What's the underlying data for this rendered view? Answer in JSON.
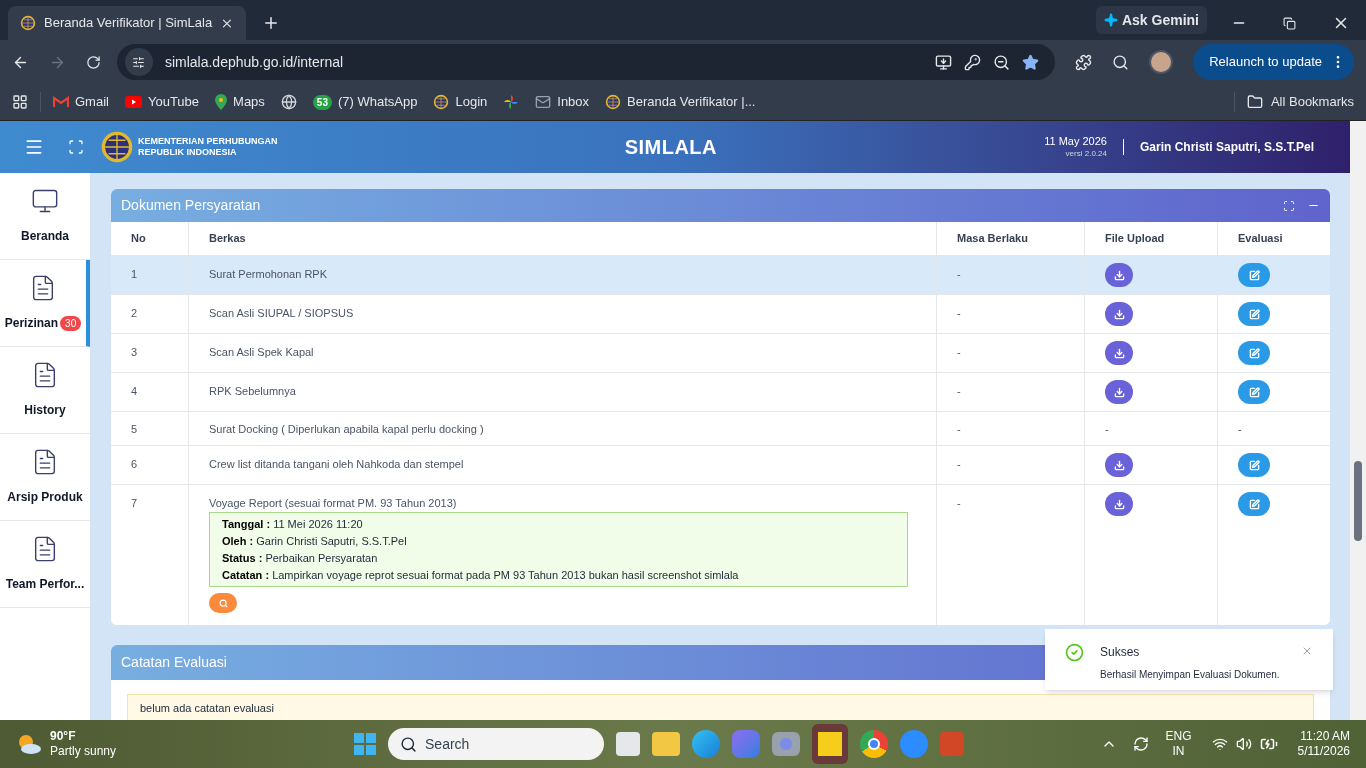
{
  "browser": {
    "tab_title": "Beranda Verifikator | SimLala",
    "address": "simlala.dephub.go.id/internal",
    "ask_gemini": "Ask Gemini",
    "relaunch": "Relaunch to update",
    "bookmarks": [
      {
        "kind": "gmail",
        "label": "Gmail"
      },
      {
        "kind": "youtube",
        "label": "YouTube"
      },
      {
        "kind": "maps",
        "label": "Maps"
      },
      {
        "kind": "globe"
      },
      {
        "kind": "whatsapp",
        "badge": "53",
        "label": "(7) WhatsApp"
      },
      {
        "kind": "emblem",
        "label": "Login"
      },
      {
        "kind": "pinwheel"
      },
      {
        "kind": "mail",
        "label": "Inbox"
      },
      {
        "kind": "emblem",
        "label": "Beranda Verifikator |..."
      }
    ],
    "all_bookmarks": "All Bookmarks"
  },
  "header": {
    "org_lines": [
      "KEMENTERIAN PERHUBUNGAN",
      "REPUBLIK INDONESIA"
    ],
    "title": "SIMLALA",
    "date": "11 May 2026",
    "version": "versi 2.0.24",
    "user": "Garin Christi Saputri, S.S.T.Pel"
  },
  "sidebar": {
    "items": [
      {
        "label": "Beranda",
        "kind": "monitor",
        "selected": false
      },
      {
        "label": "Perizinan",
        "kind": "doc",
        "badge": "30",
        "selected": true
      },
      {
        "label": "History",
        "kind": "doc",
        "selected": false
      },
      {
        "label": "Arsip Produk",
        "kind": "doc",
        "selected": false
      },
      {
        "label": "Team Perfor...",
        "kind": "doc",
        "selected": false
      }
    ]
  },
  "documents": {
    "title": "Dokumen Persyaratan",
    "columns": [
      "No",
      "Berkas",
      "Masa Berlaku",
      "File Upload",
      "Evaluasi"
    ],
    "rows": [
      {
        "no": "1",
        "berkas": "Surat Permohonan RPK",
        "masa": "-",
        "kind": "buttons",
        "selected": true
      },
      {
        "no": "2",
        "berkas": "Scan Asli SIUPAL / SIOPSUS",
        "masa": "-",
        "kind": "buttons",
        "selected": false
      },
      {
        "no": "3",
        "berkas": "Scan Asli Spek Kapal",
        "masa": "-",
        "kind": "buttons",
        "selected": false
      },
      {
        "no": "4",
        "berkas": "RPK Sebelumnya",
        "masa": "-",
        "kind": "buttons",
        "selected": false
      },
      {
        "no": "5",
        "berkas": "Surat Docking ( Diperlukan apabila kapal perlu docking )",
        "masa": "-",
        "kind": "text",
        "file_upload": "-",
        "evaluasi": "-",
        "selected": false
      },
      {
        "no": "6",
        "berkas": "Crew list ditanda tangani oleh Nahkoda dan stempel",
        "masa": "-",
        "kind": "buttons",
        "selected": false
      },
      {
        "no": "7",
        "berkas": "Voyage Report (sesuai format PM. 93 Tahun 2013)",
        "masa": "-",
        "kind": "buttons",
        "selected": false,
        "note": [
          {
            "label": "Tanggal :",
            "value": "11 Mei 2026 11:20"
          },
          {
            "label": "Oleh :",
            "value": "Garin Christi Saputri, S.S.T.Pel"
          },
          {
            "label": "Status :",
            "value": "Perbaikan Persyaratan"
          },
          {
            "label": "Catatan :",
            "value": "Lampirkan voyage reprot sesuai format pada PM 93 Tahun 2013 bukan hasil screenshot simlala"
          }
        ]
      }
    ]
  },
  "evaluation": {
    "title": "Catatan Evaluasi",
    "message": "belum ada catatan evaluasi"
  },
  "toast": {
    "title": "Sukses",
    "message": "Berhasil Menyimpan Evaluasi Dokumen."
  },
  "taskbar": {
    "temperature": "90°F",
    "condition": "Partly sunny",
    "search_placeholder": "Search",
    "language": "ENG",
    "region": "IN",
    "time": "11:20 AM",
    "date": "5/11/2026"
  }
}
